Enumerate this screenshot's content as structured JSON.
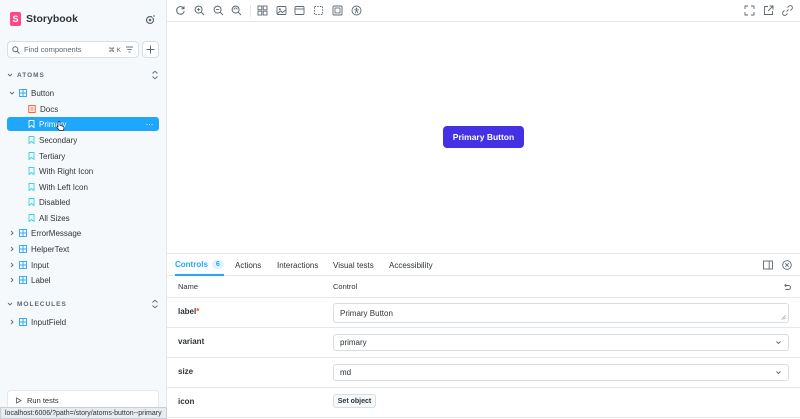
{
  "brand": {
    "name": "Storybook",
    "logo_letter": "S"
  },
  "search": {
    "placeholder": "Find components",
    "shortcut": "⌘ K"
  },
  "sidebar": {
    "sections": [
      {
        "title": "ATOMS"
      },
      {
        "title": "MOLECULES"
      }
    ],
    "items": {
      "button": "Button",
      "docs": "Docs",
      "primary": "Primary",
      "secondary": "Secondary",
      "tertiary": "Tertiary",
      "with_right_icon": "With Right Icon",
      "with_left_icon": "With Left Icon",
      "disabled": "Disabled",
      "all_sizes": "All Sizes",
      "error_message": "ErrorMessage",
      "helper_text": "HelperText",
      "input": "Input",
      "label": "Label",
      "input_field": "InputField"
    },
    "selected_more": "···",
    "run_tests": "Run tests",
    "status_url": "localhost:6006/?path=/story/atoms-button--primary"
  },
  "canvas": {
    "button_label": "Primary Button"
  },
  "panel": {
    "tabs": [
      {
        "label": "Controls",
        "count": "6"
      },
      {
        "label": "Actions"
      },
      {
        "label": "Interactions"
      },
      {
        "label": "Visual tests"
      },
      {
        "label": "Accessibility"
      }
    ],
    "columns": {
      "name": "Name",
      "control": "Control"
    },
    "rows": [
      {
        "name": "label",
        "required": "*",
        "value": "Primary Button"
      },
      {
        "name": "variant",
        "value": "primary"
      },
      {
        "name": "size",
        "value": "md"
      },
      {
        "name": "icon",
        "value": "Set object"
      }
    ]
  },
  "colors": {
    "accent": "#1ea7fd",
    "brand": "#ff4785",
    "button": "#4431e6",
    "component_icon": "#1ea7fd",
    "docs_icon": "#fc521f",
    "story_icon": "#37d5d3"
  },
  "icons": {
    "toolbar": [
      "reload-icon",
      "zoom-in-icon",
      "zoom-out-icon",
      "zoom-reset-icon",
      "grid-icon",
      "background-icon",
      "viewport-icon",
      "outline-icon",
      "measure-icon",
      "accessibility-icon",
      "fullscreen-icon",
      "open-new-tab-icon",
      "copy-link-icon"
    ]
  }
}
